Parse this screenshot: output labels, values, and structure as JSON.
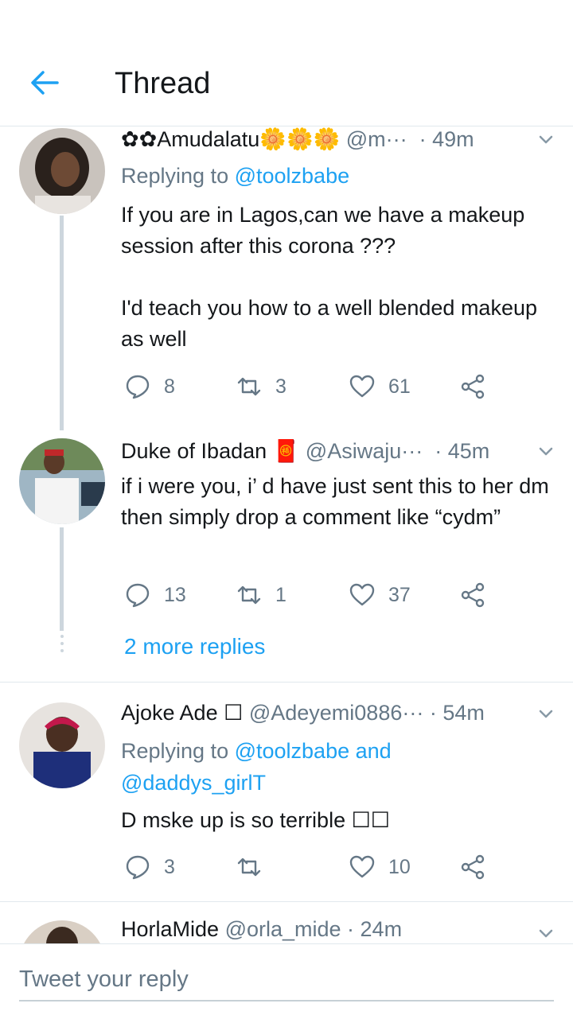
{
  "header": {
    "title": "Thread",
    "back_icon": "arrow-left-icon",
    "accent": "#1da1f2"
  },
  "tweets": [
    {
      "name": "✿✿Amudalatu🌼🌼🌼",
      "handle": "@m···",
      "time": "· 49m",
      "replying_prefix": "Replying to ",
      "replying_to": "@toolzbabe",
      "replying_extra": "",
      "text": "If you are in Lagos,can we have a makeup session after this corona ???\n\nI'd teach you how to a well blended makeup as well",
      "replies": "8",
      "retweets": "3",
      "likes": "61"
    },
    {
      "name": "Duke of Ibadan",
      "badge": "🧧",
      "handle": "@Asiwaju···",
      "time": "· 45m",
      "text": "if i were you, i’ d have just sent this to her dm then simply drop a comment like “cydm”",
      "replies": "13",
      "retweets": "1",
      "likes": "37"
    },
    {
      "name": "Ajoke Ade ☐",
      "handle": "@Adeyemi0886···",
      "time": "· 54m",
      "replying_prefix": "Replying to ",
      "replying_to": "@toolzbabe and @daddys_girlT",
      "text": "D mske up is so terrible ☐☐",
      "replies": "3",
      "retweets": "",
      "likes": "10"
    },
    {
      "name": "HorlaMide",
      "handle": "@orla_mide",
      "time": "· 24m"
    }
  ],
  "more_replies": "2 more replies",
  "reply": {
    "placeholder": "Tweet your reply"
  },
  "icons": {
    "reply": "reply-icon",
    "retweet": "retweet-icon",
    "like": "heart-icon",
    "share": "share-icon",
    "caret": "chevron-down-icon"
  }
}
